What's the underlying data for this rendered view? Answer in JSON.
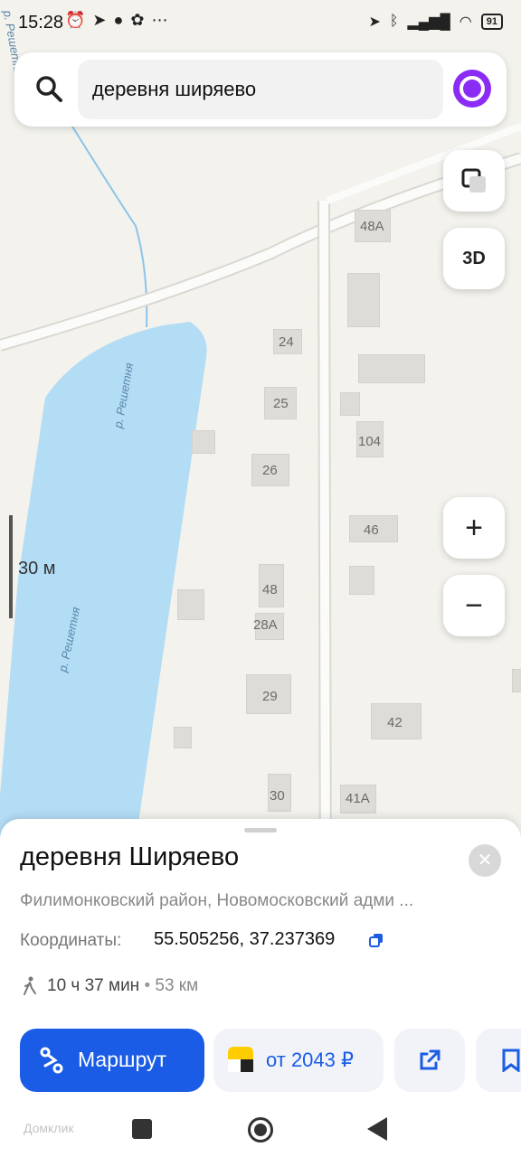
{
  "status_bar": {
    "time": "15:28",
    "battery": "91",
    "left_icons": [
      "alarm-icon",
      "telegram-icon",
      "chat-icon",
      "app-icon",
      "more-icon"
    ],
    "right_icons": [
      "location-icon",
      "bluetooth-icon",
      "signal-icon",
      "wifi-icon",
      "battery-icon"
    ]
  },
  "search": {
    "query": "деревня ширяево"
  },
  "map": {
    "layers_button": "layers-icon",
    "view_3d_label": "3D",
    "zoom_in_label": "+",
    "zoom_out_label": "−",
    "scale_label": "30 м",
    "river_labels": [
      "р. Решетня",
      "р. Решетня",
      "р. Решетня"
    ],
    "house_numbers": [
      "48А",
      "24",
      "25",
      "104",
      "26",
      "46",
      "48",
      "28А",
      "29",
      "42",
      "30",
      "41А"
    ]
  },
  "place_card": {
    "title": "деревня Ширяево",
    "address": "Филимонковский район, Новомосковский адми ...",
    "coords_label": "Координаты:",
    "coords_value": "55.505256, 37.237369",
    "walk_time": "10 ч 37 мин",
    "walk_separator": "•",
    "walk_distance": "53 км",
    "route_label": "Маршрут",
    "taxi_label": "от 2043 ₽"
  },
  "nav_bar": {
    "watermark": "Домклик"
  },
  "colors": {
    "accent": "#1a5ce6",
    "water": "#b3dcf5",
    "map_bg": "#f3f2ed",
    "alice": "#8b2cf5"
  }
}
